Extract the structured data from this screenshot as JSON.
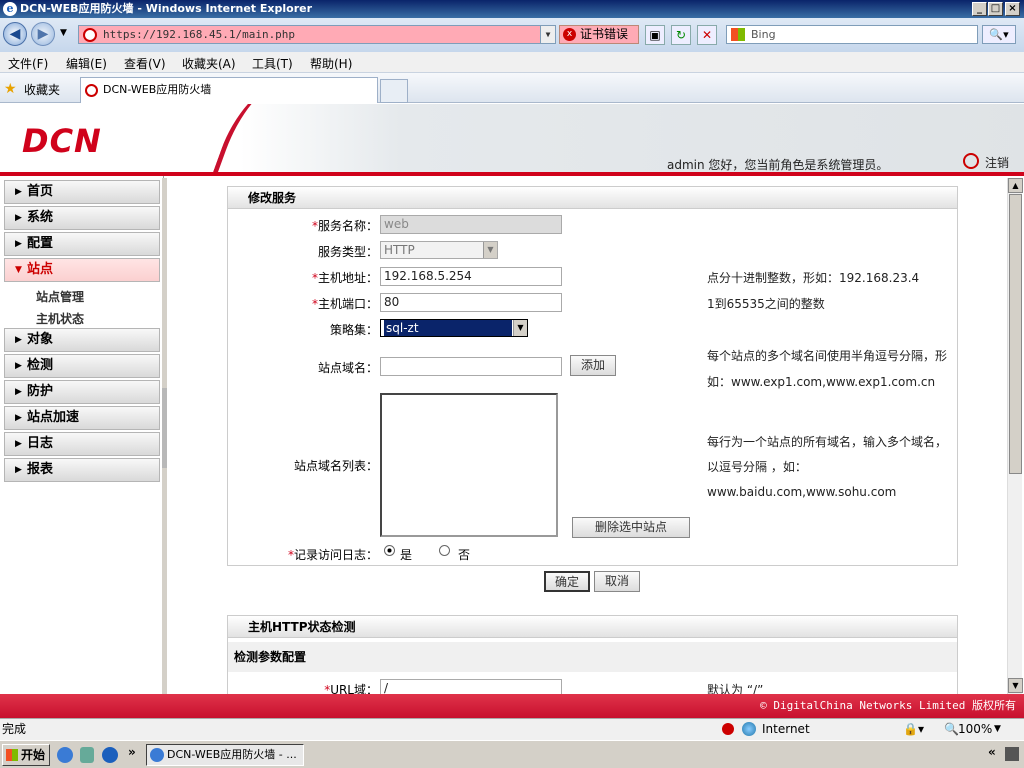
{
  "window": {
    "title": "DCN-WEB应用防火墙 - Windows Internet Explorer"
  },
  "addressbar": {
    "url": "https://192.168.45.1/main.php",
    "cert_error": "证书错误",
    "search_placeholder": "Bing"
  },
  "menu": [
    "文件(F)",
    "编辑(E)",
    "查看(V)",
    "收藏夹(A)",
    "工具(T)",
    "帮助(H)"
  ],
  "favorites": {
    "label": "收藏夹",
    "tab_title": "DCN-WEB应用防火墙"
  },
  "header": {
    "logo": "DCN",
    "welcome": "admin 您好，您当前角色是系统管理员。",
    "logout": "注销"
  },
  "sidebar": {
    "items": [
      {
        "label": "首页"
      },
      {
        "label": "系统"
      },
      {
        "label": "配置"
      },
      {
        "label": "站点",
        "active": true
      },
      {
        "label": "对象"
      },
      {
        "label": "检测"
      },
      {
        "label": "防护"
      },
      {
        "label": "站点加速"
      },
      {
        "label": "日志"
      },
      {
        "label": "报表"
      }
    ],
    "subitems": [
      "站点管理",
      "主机状态"
    ]
  },
  "form": {
    "title": "修改服务",
    "service_name_label": "服务名称：",
    "service_name_value": "web",
    "service_type_label": "服务类型：",
    "service_type_value": "HTTP",
    "host_addr_label": "主机地址：",
    "host_addr_value": "192.168.5.254",
    "host_addr_help": "点分十进制整数，形如：192.168.23.4",
    "host_port_label": "主机端口：",
    "host_port_value": "80",
    "host_port_help": "1到65535之间的整数",
    "policy_label": "策略集：",
    "policy_value": "sql-zt",
    "domain_label": "站点域名：",
    "domain_value": "",
    "add_button": "添加",
    "domain_help_1": "每个站点的多个域名间使用半角逗号分隔，形",
    "domain_help_2": "如：www.exp1.com,www.exp1.com.cn",
    "domain_list_label": "站点域名列表：",
    "domain_list_help_1": "每行为一个站点的所有域名，输入多个域名，",
    "domain_list_help_2": "以逗号分隔 ，如：",
    "domain_list_help_3": "www.baidu.com,www.sohu.com",
    "delete_button": "删除选中站点",
    "log_label": "记录访问日志：",
    "log_yes": "是",
    "log_no": "否",
    "ok_button": "确定",
    "cancel_button": "取消"
  },
  "health": {
    "title": "主机HTTP状态检测",
    "subtitle": "检测参数配置",
    "url_label": "URL域：",
    "url_value": "/",
    "url_help": "默认为 “/”"
  },
  "footer": {
    "copyright": "© DigitalChina Networks Limited 版权所有"
  },
  "statusbar": {
    "status": "完成",
    "zone": "Internet",
    "zoom": "100%"
  },
  "taskbar": {
    "start": "开始",
    "task": "DCN-WEB应用防火墙 - ..."
  },
  "colors": {
    "brand_red": "#d0021b",
    "required_mark": "#d0021b"
  }
}
